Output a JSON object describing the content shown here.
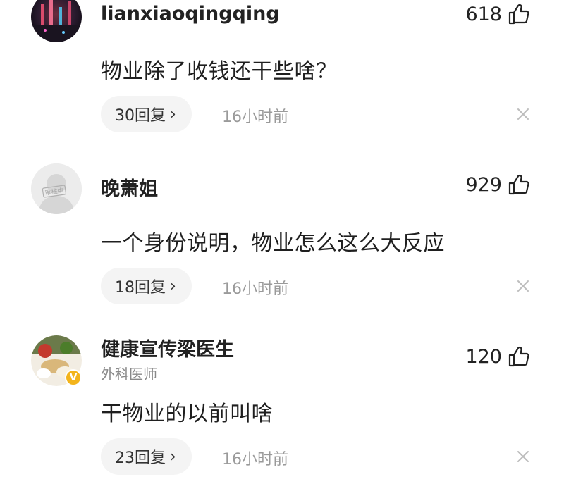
{
  "comments": [
    {
      "username": "lianxiaoqingqing",
      "subtitle": "",
      "likes": "618",
      "text": "物业除了收钱还干些啥？",
      "replies": "30回复",
      "time": "16小时前"
    },
    {
      "username": "晚萧姐",
      "subtitle": "",
      "avatar_badge": "审核中",
      "likes": "929",
      "text": "一个身份说明，物业怎么这么大反应",
      "replies": "18回复",
      "time": "16小时前"
    },
    {
      "username": "健康宣传梁医生",
      "subtitle": "外科医师",
      "verified_badge": "V",
      "likes": "120",
      "text": "干物业的以前叫啥",
      "replies": "23回复",
      "time": "16小时前"
    }
  ],
  "icons": {
    "like": "thumbs-up-icon",
    "close": "close-icon",
    "reply_arrow": "chevron-right-icon"
  },
  "chevron_glyph": "›",
  "colors": {
    "pill_background": "#f4f4f4",
    "muted_text": "#9a9a9a",
    "verified_badge": "#f3b41b"
  }
}
